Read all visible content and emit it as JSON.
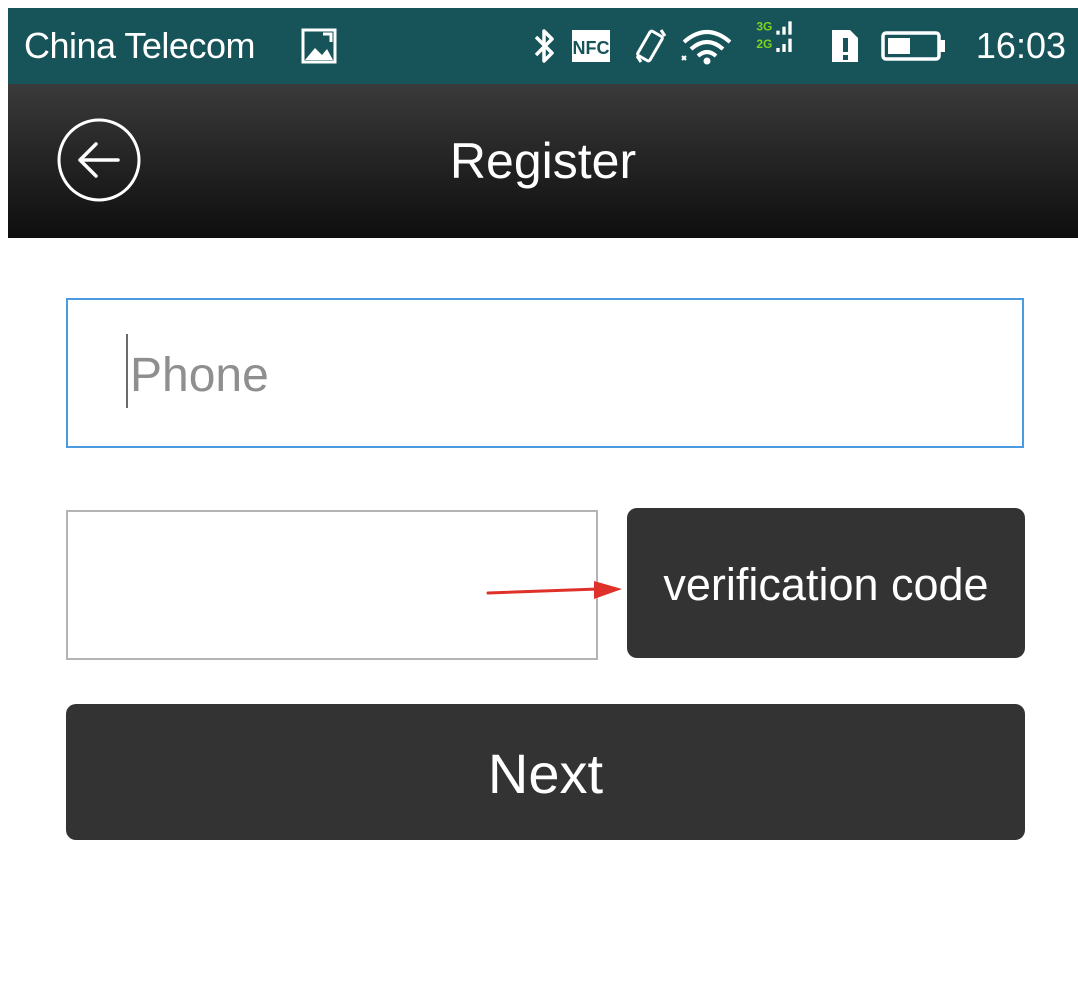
{
  "status_bar": {
    "carrier": "China Telecom",
    "network_3g": "3G",
    "network_2g": "2G",
    "nfc_label": "NFC",
    "time": "16:03",
    "icons": [
      "image-icon",
      "bluetooth-icon",
      "nfc-icon",
      "vibrate-icon",
      "wifi-icon",
      "signal-icon",
      "sim-alert-icon",
      "battery-icon"
    ],
    "background_color": "#17545a"
  },
  "header": {
    "title": "Register",
    "back_icon": "back-arrow-circle-icon"
  },
  "form": {
    "phone_placeholder": "Phone",
    "phone_value": "",
    "code_value": "",
    "verification_button_label": "verification code",
    "next_button_label": "Next",
    "focus_border_color": "#4a9be0",
    "button_color": "#333333"
  },
  "annotation": {
    "arrow_color": "#e0302a"
  }
}
